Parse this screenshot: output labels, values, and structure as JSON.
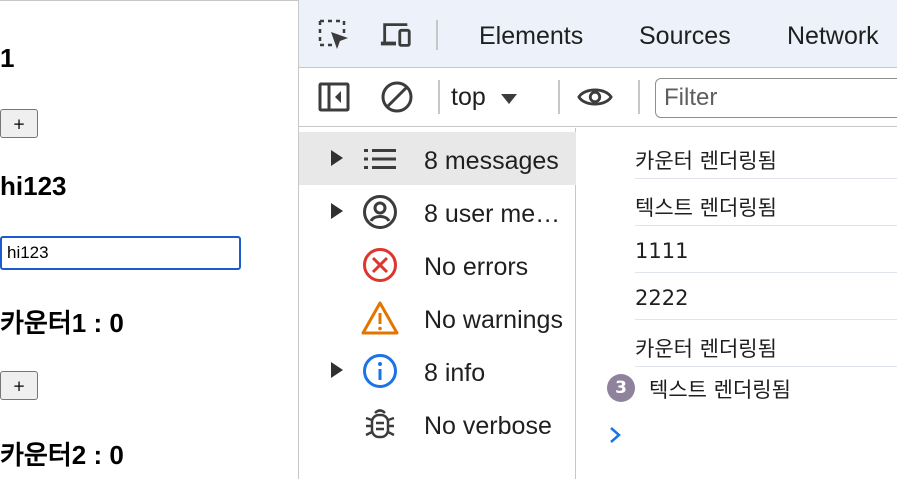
{
  "app": {
    "count_heading": "1",
    "plus_label": "+",
    "text_heading": "hi123",
    "text_input_value": "hi123",
    "counter1_heading": "카운터1 : 0",
    "counter2_heading": "카운터2 : 0"
  },
  "devtools": {
    "tabs": [
      "Elements",
      "Sources",
      "Network"
    ],
    "context": "top",
    "filter_placeholder": "Filter",
    "sidebar": [
      {
        "label": "8 messages",
        "icon": "list-icon",
        "expandable": true,
        "selected": true
      },
      {
        "label": "8 user me…",
        "icon": "user-icon",
        "expandable": true,
        "selected": false
      },
      {
        "label": "No errors",
        "icon": "error-icon",
        "expandable": false,
        "selected": false
      },
      {
        "label": "No warnings",
        "icon": "warning-icon",
        "expandable": false,
        "selected": false
      },
      {
        "label": "8 info",
        "icon": "info-icon",
        "expandable": true,
        "selected": false
      },
      {
        "label": "No verbose",
        "icon": "bug-icon",
        "expandable": false,
        "selected": false
      }
    ],
    "console_lines": [
      "카운터 렌더링됨",
      "텍스트 렌더링됨",
      "1111",
      "2222",
      "카운터 렌더링됨",
      "텍스트 렌더링됨"
    ],
    "repeat_count": "3",
    "colors": {
      "accent_blue": "#1a5cd0",
      "error_red": "#dc362e",
      "warning_orange": "#e37400",
      "info_blue": "#1a73e8",
      "badge_purple": "#8f829c",
      "tabbar_bg": "#edf2fa"
    }
  }
}
